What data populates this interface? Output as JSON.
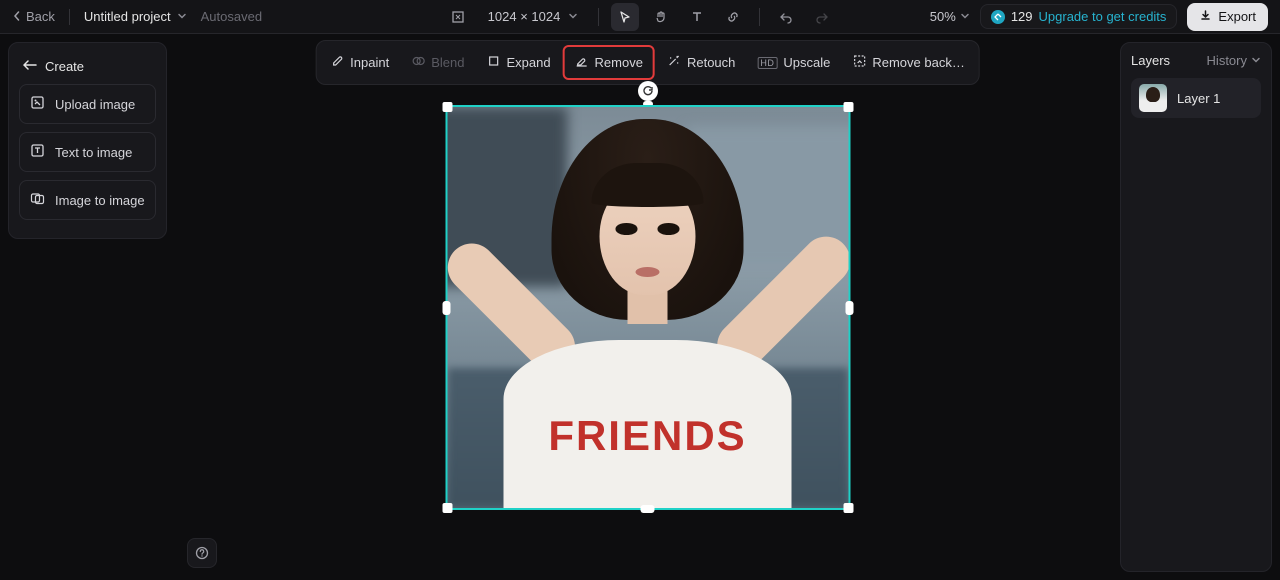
{
  "header": {
    "back_label": "Back",
    "project_name": "Untitled project",
    "autosave_label": "Autosaved",
    "dimensions": "1024 × 1024",
    "zoom_label": "50%",
    "credits_value": "129",
    "upgrade_label": "Upgrade to get credits",
    "export_label": "Export"
  },
  "create": {
    "title": "Create",
    "items": {
      "upload": "Upload image",
      "text2img": "Text to image",
      "img2img": "Image to image"
    }
  },
  "actions": {
    "inpaint": "Inpaint",
    "blend": "Blend",
    "expand": "Expand",
    "remove": "Remove",
    "retouch": "Retouch",
    "upscale": "Upscale",
    "remove_bg": "Remove back…"
  },
  "canvas": {
    "shirt_text": "FRIENDS"
  },
  "layers": {
    "title": "Layers",
    "history_label": "History",
    "items": [
      {
        "name": "Layer 1"
      }
    ]
  },
  "colors": {
    "selection_border": "#1fd1c7",
    "highlight_border": "#e23b3b",
    "link": "#27b3cf"
  }
}
